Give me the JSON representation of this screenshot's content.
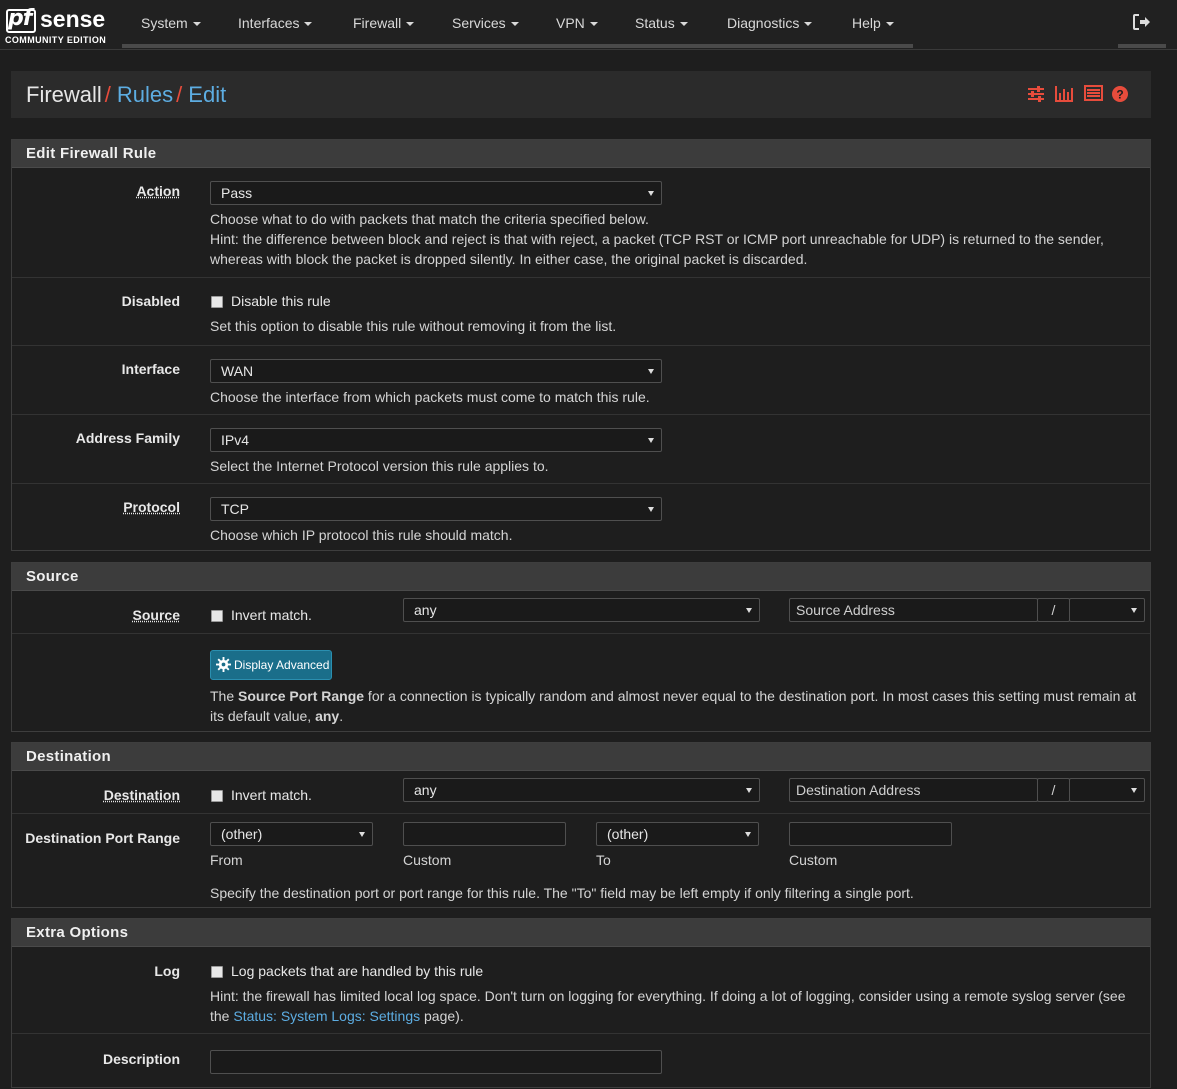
{
  "brand": {
    "name_pf": "pf",
    "name_sense": "sense",
    "edition": "COMMUNITY EDITION"
  },
  "nav": {
    "items": [
      {
        "label": "System"
      },
      {
        "label": "Interfaces"
      },
      {
        "label": "Firewall"
      },
      {
        "label": "Services"
      },
      {
        "label": "VPN"
      },
      {
        "label": "Status"
      },
      {
        "label": "Diagnostics"
      },
      {
        "label": "Help"
      }
    ]
  },
  "breadcrumb": {
    "root": "Firewall",
    "sep": "/",
    "level2": "Rules",
    "level3": "Edit"
  },
  "edit_rule": {
    "title": "Edit Firewall Rule",
    "action": {
      "label": "Action",
      "value": "Pass",
      "help1": "Choose what to do with packets that match the criteria specified below.",
      "help2": "Hint: the difference between block and reject is that with reject, a packet (TCP RST or ICMP port unreachable for UDP) is returned to the sender,",
      "help3": "whereas with block the packet is dropped silently. In either case, the original packet is discarded."
    },
    "disabled": {
      "label": "Disabled",
      "checkbox_label": "Disable this rule",
      "help": "Set this option to disable this rule without removing it from the list."
    },
    "interface": {
      "label": "Interface",
      "value": "WAN",
      "help": "Choose the interface from which packets must come to match this rule."
    },
    "address_family": {
      "label": "Address Family",
      "value": "IPv4",
      "help": "Select the Internet Protocol version this rule applies to."
    },
    "protocol": {
      "label": "Protocol",
      "value": "TCP",
      "help": "Choose which IP protocol this rule should match."
    }
  },
  "source": {
    "title": "Source",
    "label": "Source",
    "invert_label": "Invert match.",
    "type_value": "any",
    "address_placeholder": "Source Address",
    "slash": "/",
    "advanced_button": "Display Advanced",
    "help_pre": "The ",
    "help_bold": "Source Port Range",
    "help_mid": " for a connection is typically random and almost never equal to the destination port. In most cases this setting must remain at",
    "help_line2_pre": "its default value, ",
    "help_line2_bold": "any",
    "help_line2_post": "."
  },
  "destination": {
    "title": "Destination",
    "label": "Destination",
    "invert_label": "Invert match.",
    "type_value": "any",
    "address_placeholder": "Destination Address",
    "slash": "/",
    "port_range_label": "Destination Port Range",
    "from_value": "(other)",
    "to_value": "(other)",
    "from_label": "From",
    "custom_label": "Custom",
    "to_label": "To",
    "help": "Specify the destination port or port range for this rule. The \"To\" field may be left empty if only filtering a single port."
  },
  "extra": {
    "title": "Extra Options",
    "log_label": "Log",
    "log_checkbox_label": "Log packets that are handled by this rule",
    "log_help1": "Hint: the firewall has limited local log space. Don't turn on logging for everything. If doing a lot of logging, consider using a remote syslog server (see",
    "log_help2_pre": "the ",
    "log_help2_link": "Status: System Logs: Settings",
    "log_help2_post": " page).",
    "description_label": "Description"
  },
  "colors": {
    "accent_red": "#e74c3c",
    "link_blue": "#5dade2",
    "button_teal": "#1a6e8a"
  }
}
